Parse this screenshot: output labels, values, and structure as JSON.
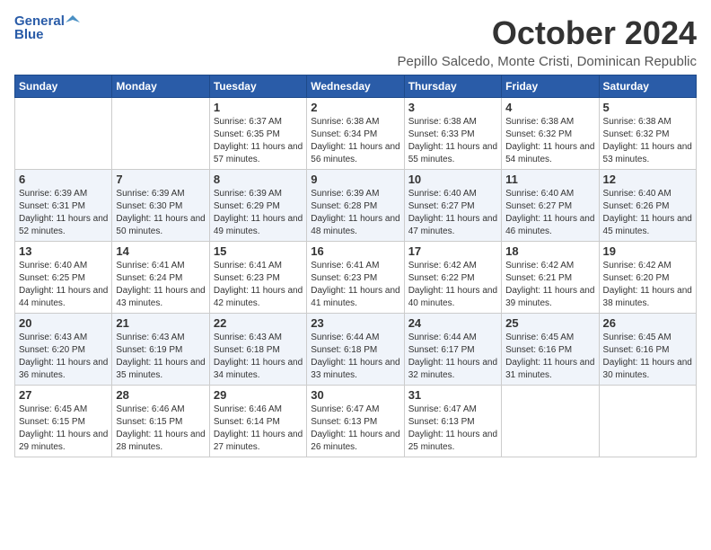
{
  "logo": {
    "general": "General",
    "blue": "Blue"
  },
  "header": {
    "month": "October 2024",
    "location": "Pepillo Salcedo, Monte Cristi, Dominican Republic"
  },
  "weekdays": [
    "Sunday",
    "Monday",
    "Tuesday",
    "Wednesday",
    "Thursday",
    "Friday",
    "Saturday"
  ],
  "weeks": [
    [
      {
        "day": "",
        "sunrise": "",
        "sunset": "",
        "daylight": ""
      },
      {
        "day": "",
        "sunrise": "",
        "sunset": "",
        "daylight": ""
      },
      {
        "day": "1",
        "sunrise": "Sunrise: 6:37 AM",
        "sunset": "Sunset: 6:35 PM",
        "daylight": "Daylight: 11 hours and 57 minutes."
      },
      {
        "day": "2",
        "sunrise": "Sunrise: 6:38 AM",
        "sunset": "Sunset: 6:34 PM",
        "daylight": "Daylight: 11 hours and 56 minutes."
      },
      {
        "day": "3",
        "sunrise": "Sunrise: 6:38 AM",
        "sunset": "Sunset: 6:33 PM",
        "daylight": "Daylight: 11 hours and 55 minutes."
      },
      {
        "day": "4",
        "sunrise": "Sunrise: 6:38 AM",
        "sunset": "Sunset: 6:32 PM",
        "daylight": "Daylight: 11 hours and 54 minutes."
      },
      {
        "day": "5",
        "sunrise": "Sunrise: 6:38 AM",
        "sunset": "Sunset: 6:32 PM",
        "daylight": "Daylight: 11 hours and 53 minutes."
      }
    ],
    [
      {
        "day": "6",
        "sunrise": "Sunrise: 6:39 AM",
        "sunset": "Sunset: 6:31 PM",
        "daylight": "Daylight: 11 hours and 52 minutes."
      },
      {
        "day": "7",
        "sunrise": "Sunrise: 6:39 AM",
        "sunset": "Sunset: 6:30 PM",
        "daylight": "Daylight: 11 hours and 50 minutes."
      },
      {
        "day": "8",
        "sunrise": "Sunrise: 6:39 AM",
        "sunset": "Sunset: 6:29 PM",
        "daylight": "Daylight: 11 hours and 49 minutes."
      },
      {
        "day": "9",
        "sunrise": "Sunrise: 6:39 AM",
        "sunset": "Sunset: 6:28 PM",
        "daylight": "Daylight: 11 hours and 48 minutes."
      },
      {
        "day": "10",
        "sunrise": "Sunrise: 6:40 AM",
        "sunset": "Sunset: 6:27 PM",
        "daylight": "Daylight: 11 hours and 47 minutes."
      },
      {
        "day": "11",
        "sunrise": "Sunrise: 6:40 AM",
        "sunset": "Sunset: 6:27 PM",
        "daylight": "Daylight: 11 hours and 46 minutes."
      },
      {
        "day": "12",
        "sunrise": "Sunrise: 6:40 AM",
        "sunset": "Sunset: 6:26 PM",
        "daylight": "Daylight: 11 hours and 45 minutes."
      }
    ],
    [
      {
        "day": "13",
        "sunrise": "Sunrise: 6:40 AM",
        "sunset": "Sunset: 6:25 PM",
        "daylight": "Daylight: 11 hours and 44 minutes."
      },
      {
        "day": "14",
        "sunrise": "Sunrise: 6:41 AM",
        "sunset": "Sunset: 6:24 PM",
        "daylight": "Daylight: 11 hours and 43 minutes."
      },
      {
        "day": "15",
        "sunrise": "Sunrise: 6:41 AM",
        "sunset": "Sunset: 6:23 PM",
        "daylight": "Daylight: 11 hours and 42 minutes."
      },
      {
        "day": "16",
        "sunrise": "Sunrise: 6:41 AM",
        "sunset": "Sunset: 6:23 PM",
        "daylight": "Daylight: 11 hours and 41 minutes."
      },
      {
        "day": "17",
        "sunrise": "Sunrise: 6:42 AM",
        "sunset": "Sunset: 6:22 PM",
        "daylight": "Daylight: 11 hours and 40 minutes."
      },
      {
        "day": "18",
        "sunrise": "Sunrise: 6:42 AM",
        "sunset": "Sunset: 6:21 PM",
        "daylight": "Daylight: 11 hours and 39 minutes."
      },
      {
        "day": "19",
        "sunrise": "Sunrise: 6:42 AM",
        "sunset": "Sunset: 6:20 PM",
        "daylight": "Daylight: 11 hours and 38 minutes."
      }
    ],
    [
      {
        "day": "20",
        "sunrise": "Sunrise: 6:43 AM",
        "sunset": "Sunset: 6:20 PM",
        "daylight": "Daylight: 11 hours and 36 minutes."
      },
      {
        "day": "21",
        "sunrise": "Sunrise: 6:43 AM",
        "sunset": "Sunset: 6:19 PM",
        "daylight": "Daylight: 11 hours and 35 minutes."
      },
      {
        "day": "22",
        "sunrise": "Sunrise: 6:43 AM",
        "sunset": "Sunset: 6:18 PM",
        "daylight": "Daylight: 11 hours and 34 minutes."
      },
      {
        "day": "23",
        "sunrise": "Sunrise: 6:44 AM",
        "sunset": "Sunset: 6:18 PM",
        "daylight": "Daylight: 11 hours and 33 minutes."
      },
      {
        "day": "24",
        "sunrise": "Sunrise: 6:44 AM",
        "sunset": "Sunset: 6:17 PM",
        "daylight": "Daylight: 11 hours and 32 minutes."
      },
      {
        "day": "25",
        "sunrise": "Sunrise: 6:45 AM",
        "sunset": "Sunset: 6:16 PM",
        "daylight": "Daylight: 11 hours and 31 minutes."
      },
      {
        "day": "26",
        "sunrise": "Sunrise: 6:45 AM",
        "sunset": "Sunset: 6:16 PM",
        "daylight": "Daylight: 11 hours and 30 minutes."
      }
    ],
    [
      {
        "day": "27",
        "sunrise": "Sunrise: 6:45 AM",
        "sunset": "Sunset: 6:15 PM",
        "daylight": "Daylight: 11 hours and 29 minutes."
      },
      {
        "day": "28",
        "sunrise": "Sunrise: 6:46 AM",
        "sunset": "Sunset: 6:15 PM",
        "daylight": "Daylight: 11 hours and 28 minutes."
      },
      {
        "day": "29",
        "sunrise": "Sunrise: 6:46 AM",
        "sunset": "Sunset: 6:14 PM",
        "daylight": "Daylight: 11 hours and 27 minutes."
      },
      {
        "day": "30",
        "sunrise": "Sunrise: 6:47 AM",
        "sunset": "Sunset: 6:13 PM",
        "daylight": "Daylight: 11 hours and 26 minutes."
      },
      {
        "day": "31",
        "sunrise": "Sunrise: 6:47 AM",
        "sunset": "Sunset: 6:13 PM",
        "daylight": "Daylight: 11 hours and 25 minutes."
      },
      {
        "day": "",
        "sunrise": "",
        "sunset": "",
        "daylight": ""
      },
      {
        "day": "",
        "sunrise": "",
        "sunset": "",
        "daylight": ""
      }
    ]
  ]
}
